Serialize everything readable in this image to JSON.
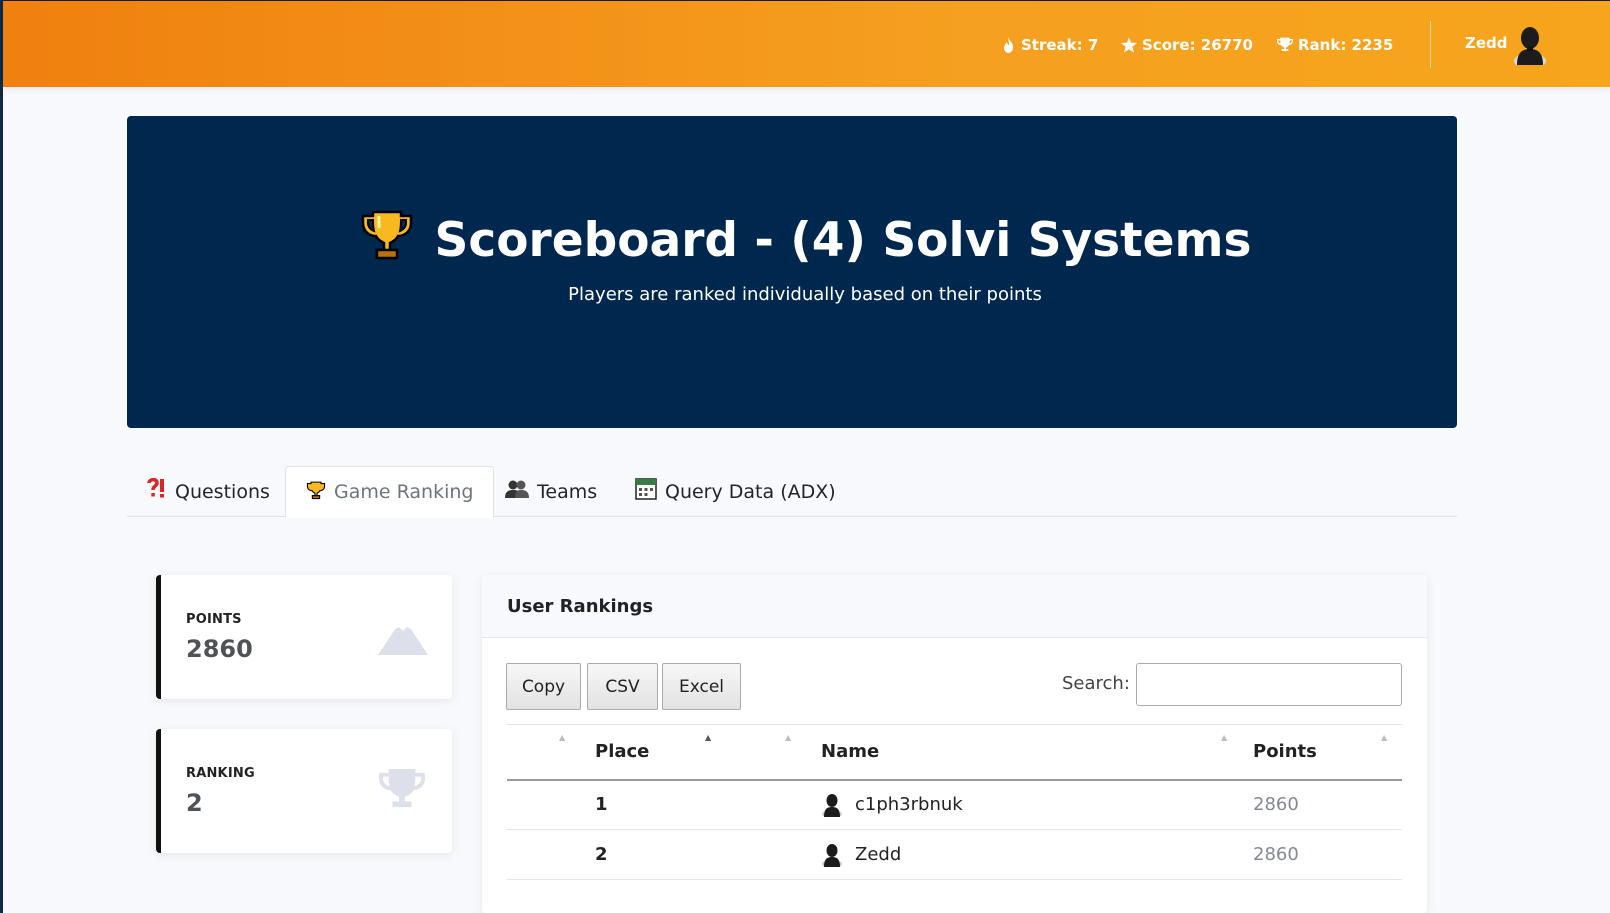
{
  "topbar": {
    "streak": "Streak: 7",
    "score": "Score: 26770",
    "rank": "Rank: 2235",
    "user": "Zedd",
    "icons": [
      "fire-icon",
      "star-icon",
      "trophy-icon",
      "user-avatar"
    ]
  },
  "hero": {
    "title": "Scoreboard - (4) Solvi Systems",
    "subtitle": "Players are ranked individually based on their points",
    "icon": "trophy-emoji"
  },
  "tabs": [
    {
      "label": "Questions",
      "icon": "question-exclamation-emoji"
    },
    {
      "label": "Game Ranking",
      "icon": "trophy-emoji",
      "active": true
    },
    {
      "label": "Teams",
      "icon": "people-emoji"
    },
    {
      "label": "Query Data (ADX)",
      "icon": "calendar-emoji"
    }
  ],
  "cards": {
    "points": {
      "label": "POINTS",
      "value": "2860",
      "icon": "mountain-icon"
    },
    "ranking": {
      "label": "RANKING",
      "value": "2",
      "icon": "trophy-icon"
    }
  },
  "rankings": {
    "title": "User Rankings",
    "buttons": {
      "copy": "Copy",
      "csv": "CSV",
      "excel": "Excel"
    },
    "search_label": "Search:",
    "search_value": "",
    "columns": [
      "Place",
      "Name",
      "Points"
    ],
    "rows": [
      {
        "place": "1",
        "name": "c1ph3rbnuk",
        "points": "2860"
      },
      {
        "place": "2",
        "name": "Zedd",
        "points": "2860"
      }
    ]
  },
  "colors": {
    "topbar_start": "#f0800f",
    "topbar_end": "#f6a51c",
    "hero_bg": "#00274d",
    "card_accent": "#111111"
  }
}
